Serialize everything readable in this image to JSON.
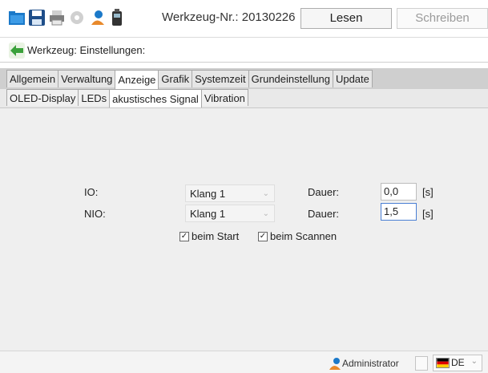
{
  "toolbar": {
    "title": "Werkzeug-Nr.: 20130226",
    "read_label": "Lesen",
    "write_label": "Schreiben"
  },
  "header": {
    "title": "Werkzeug: Einstellungen:"
  },
  "tabs_main": [
    "Allgemein",
    "Verwaltung",
    "Anzeige",
    "Grafik",
    "Systemzeit",
    "Grundeinstellung",
    "Update"
  ],
  "tabs_main_active": "Anzeige",
  "tabs_sub": [
    "OLED-Display",
    "LEDs",
    "akustisches Signal",
    "Vibration"
  ],
  "tabs_sub_active": "akustisches Signal",
  "form": {
    "io": {
      "label": "IO:",
      "sound": "Klang 1",
      "duration_label": "Dauer:",
      "duration": "0,0",
      "unit": "[s]"
    },
    "nio": {
      "label": "NIO:",
      "sound": "Klang 1",
      "duration_label": "Dauer:",
      "duration": "1,5",
      "unit": "[s]"
    },
    "on_start": {
      "label": "beim Start",
      "checked": true
    },
    "on_scan": {
      "label": "beim Scannen",
      "checked": true
    }
  },
  "status": {
    "user": "Administrator",
    "language": "DE"
  },
  "colors": {
    "accent_green": "#3aa13a",
    "focus_blue": "#4a7fd4",
    "user_orange": "#e8892b"
  }
}
